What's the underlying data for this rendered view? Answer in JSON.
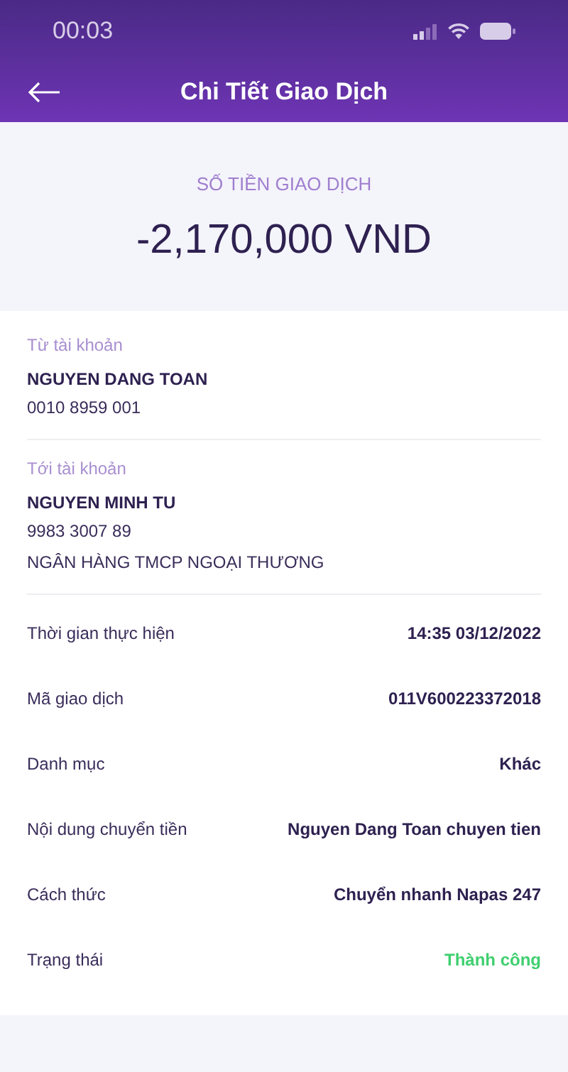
{
  "status_bar": {
    "time": "00:03"
  },
  "header": {
    "title": "Chi Tiết Giao Dịch"
  },
  "amount": {
    "label": "SỐ TIỀN GIAO DỊCH",
    "value": "-2,170,000 VND"
  },
  "accounts": [
    {
      "label": "Từ tài khoản",
      "name": "NGUYEN DANG TOAN",
      "lines": [
        "0010 8959 001"
      ]
    },
    {
      "label": "Tới tài khoản",
      "name": "NGUYEN MINH TU",
      "lines": [
        "9983 3007 89",
        "NGÂN HÀNG TMCP NGOẠI THƯƠNG"
      ]
    }
  ],
  "details": [
    {
      "label": "Thời gian thực hiện",
      "value": "14:35 03/12/2022",
      "kind": "plain"
    },
    {
      "label": "Mã giao dịch",
      "value": "011V600223372018",
      "kind": "plain"
    },
    {
      "label": "Danh mục",
      "value": "Khác",
      "kind": "plain"
    },
    {
      "label": "Nội dung chuyển tiền",
      "value": "Nguyen Dang Toan chuyen tien",
      "kind": "plain"
    },
    {
      "label": "Cách thức",
      "value": "Chuyển nhanh Napas 247",
      "kind": "plain"
    },
    {
      "label": "Trạng thái",
      "value": "Thành công",
      "kind": "success"
    }
  ]
}
